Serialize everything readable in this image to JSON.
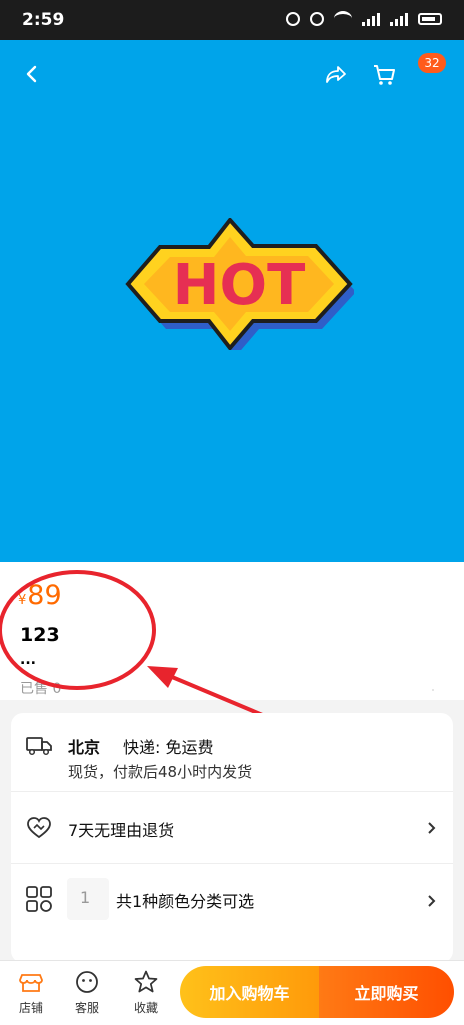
{
  "status_bar": {
    "time": "2:59",
    "icons": [
      "alarm-icon",
      "muted-bell-icon",
      "wifi-icon",
      "signal-icon",
      "signal-icon",
      "battery-icon"
    ]
  },
  "header": {
    "cart_badge": "32"
  },
  "hero": {
    "image_text": "HOT",
    "background_color": "#00a4ea"
  },
  "product": {
    "currency": "¥",
    "price": "89",
    "title": "123",
    "ellipsis": "...",
    "sold": "已售 0"
  },
  "shipping": {
    "city": "北京",
    "delivery": "快递: 免运费",
    "note": "现货，付款后48小时内发货"
  },
  "service": {
    "returns": "7天无理由退货"
  },
  "variant": {
    "count": "1",
    "text": "共1种颜色分类可选"
  },
  "bottom_bar": {
    "tabs": [
      {
        "label": "店铺",
        "icon": "store-icon"
      },
      {
        "label": "客服",
        "icon": "customer-service-icon"
      },
      {
        "label": "收藏",
        "icon": "star-icon"
      }
    ],
    "add_to_cart": "加入购物车",
    "buy_now": "立即购买"
  },
  "colors": {
    "accent": "#ff6a00",
    "hero_blue": "#00a4ea",
    "annotation_red": "#e8242d"
  }
}
